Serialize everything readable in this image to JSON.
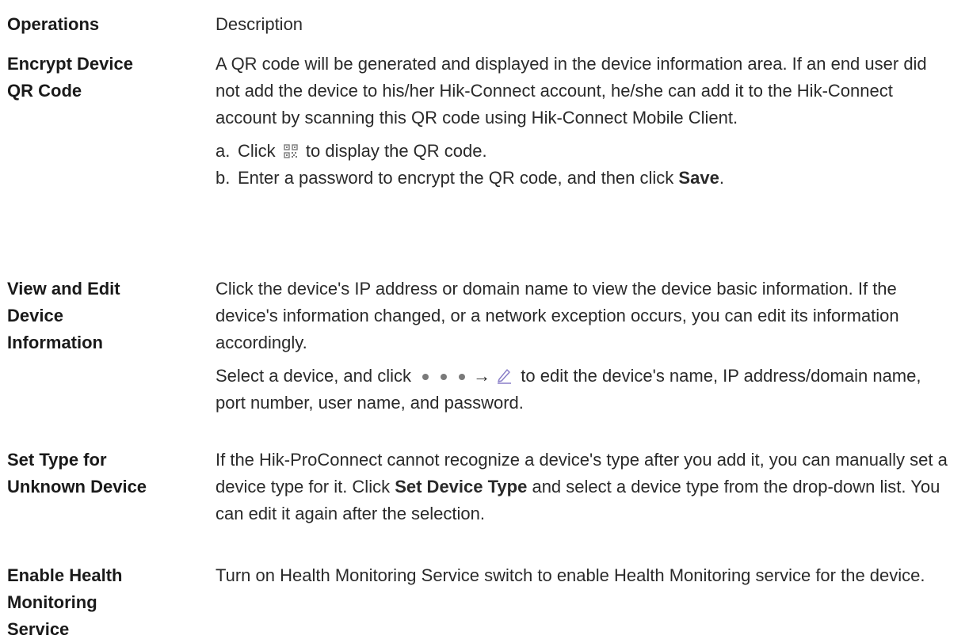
{
  "header": {
    "operations": "Operations",
    "description": "Description"
  },
  "rows": [
    {
      "operation": [
        "Encrypt Device",
        "QR Code"
      ],
      "paragraphs": [
        "A QR code will be generated and displayed in the device information area. If an end user did not add the device to his/her Hik-Connect account, he/she can add it to the Hik-Connect account by scanning this QR code using Hik-Connect Mobile Client."
      ],
      "steps": [
        {
          "letter": "a.",
          "before": "Click",
          "icon": "qr-code-icon",
          "after": "to display the QR code."
        },
        {
          "letter": "b.",
          "text": "Enter a password to encrypt the QR code, and then click",
          "bold": "Save",
          "end": "."
        }
      ]
    },
    {
      "operation": [
        "View and Edit",
        "Device",
        "Information"
      ],
      "paragraphs": [
        "Click the device's IP address or domain name to view the device basic information. If the device's information changed, or a network exception occurs, you can edit its information accordingly."
      ],
      "select_line": {
        "before": "Select a device, and click",
        "icons": [
          "more-dots-icon",
          "arrow-right-icon",
          "edit-pencil-icon"
        ],
        "after": "to edit the device's name, IP address/domain name, port number, user name, and password."
      }
    },
    {
      "operation": [
        "Set Type for",
        "Unknown Device"
      ],
      "text_before": "If the Hik-ProConnect cannot recognize a device's type after you add it, you can manually set a device type for it. Click",
      "bold": "Set Device Type",
      "text_after": "and select a device type from the drop-down list. You can edit it again after the selection."
    },
    {
      "operation": [
        "Enable Health",
        "Monitoring",
        "Service"
      ],
      "paragraphs": [
        "Turn on Health Monitoring Service switch to enable Health Monitoring service for the device."
      ]
    }
  ],
  "colors": {
    "text": "#1f1f1f",
    "icon_gray": "#7a7a7a",
    "pencil_purple": "#8a7fc8"
  }
}
